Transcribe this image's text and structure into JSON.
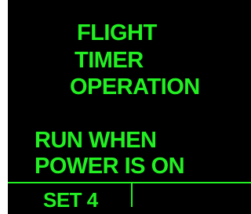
{
  "display": {
    "title_lines": [
      "FLIGHT",
      "TIMER",
      "OPERATION"
    ],
    "mode_lines": [
      "RUN WHEN",
      "POWER IS ON"
    ],
    "softkey_label": "SET 4",
    "text_color": "#22f022",
    "background_color": "#000000"
  }
}
